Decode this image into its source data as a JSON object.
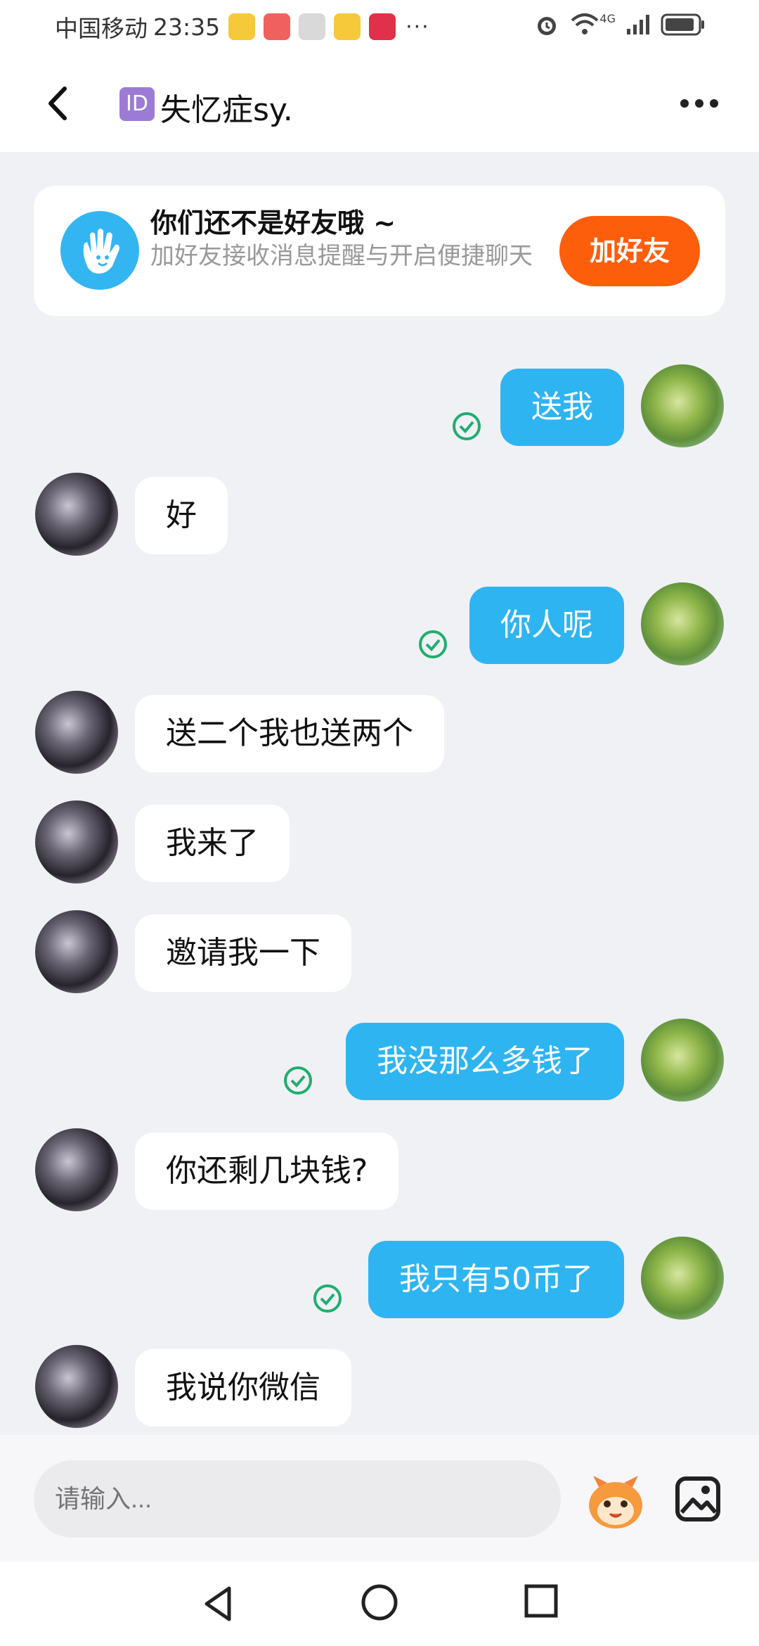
{
  "status_bar": {
    "carrier": "中国移动",
    "time": "23:35",
    "more": "···",
    "network": "4G"
  },
  "header": {
    "id_badge": "ID",
    "title": "失忆症sy."
  },
  "friend_notice": {
    "title": "你们还不是好友哦 ~",
    "subtitle": "加好友接收消息提醒与开启便捷聊天",
    "button_label": "加好友"
  },
  "messages": [
    {
      "side": "out",
      "text": "送我",
      "read": true
    },
    {
      "side": "in",
      "text": "好"
    },
    {
      "side": "out",
      "text": "你人呢",
      "read": true
    },
    {
      "side": "in",
      "text": "送二个我也送两个"
    },
    {
      "side": "in",
      "text": "我来了"
    },
    {
      "side": "in",
      "text": "邀请我一下"
    },
    {
      "side": "out",
      "text": "我没那么多钱了",
      "read": true
    },
    {
      "side": "in",
      "text": "你还剩几块钱?"
    },
    {
      "side": "out",
      "text": "我只有50币了",
      "read": true
    },
    {
      "side": "in",
      "text": "我说你微信"
    }
  ],
  "input": {
    "placeholder": "请输入..."
  },
  "colors": {
    "accent_blue": "#2fb4f2",
    "add_friend_orange": "#fd5e0c",
    "read_check_green": "#1fae6f"
  },
  "icons": {
    "back": "chevron-left-icon",
    "more": "more-icon",
    "emoji": "emoji-icon",
    "image": "image-icon",
    "read": "read-check-icon"
  }
}
